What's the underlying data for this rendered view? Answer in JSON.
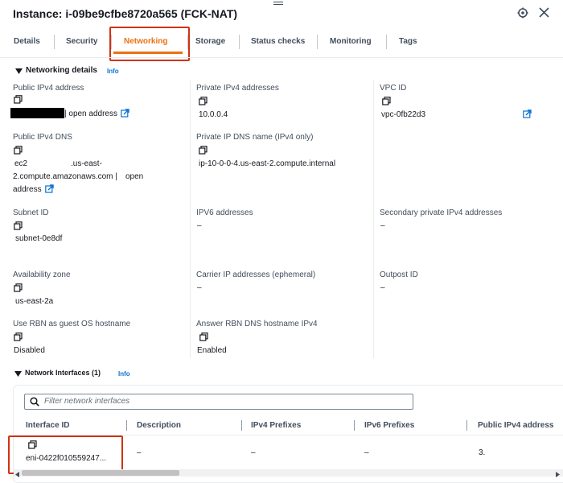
{
  "header": {
    "title": "Instance: i-09be9cfbe8720a565 (FCK-NAT)"
  },
  "tabs": [
    {
      "label": "Details"
    },
    {
      "label": "Security"
    },
    {
      "label": "Networking"
    },
    {
      "label": "Storage"
    },
    {
      "label": "Status checks"
    },
    {
      "label": "Monitoring"
    },
    {
      "label": "Tags"
    }
  ],
  "networking_details": {
    "heading": "Networking details",
    "info": "Info",
    "public_ipv4_address": {
      "label": "Public IPv4 address",
      "link": "| open address"
    },
    "private_ipv4_addresses": {
      "label": "Private IPv4 addresses",
      "value": "10.0.0.4"
    },
    "vpc_id": {
      "label": "VPC ID",
      "value": "vpc-0fb22d3"
    },
    "public_ipv4_dns": {
      "label": "Public IPv4 DNS",
      "line1_a": "ec2",
      "line1_b": ".us-east-",
      "line2": "2.compute.amazonaws.com |",
      "link_a": "open",
      "link_b": "address"
    },
    "private_ip_dns_name": {
      "label": "Private IP DNS name (IPv4 only)",
      "value": "ip-10-0-0-4.us-east-2.compute.internal"
    },
    "subnet_id": {
      "label": "Subnet ID",
      "value": "subnet-0e8df"
    },
    "ipv6_addresses": {
      "label": "IPV6 addresses",
      "value": "–"
    },
    "secondary_private_ipv4": {
      "label": "Secondary private IPv4 addresses",
      "value": "–"
    },
    "availability_zone": {
      "label": "Availability zone",
      "value": "us-east-2a"
    },
    "carrier_ip": {
      "label": "Carrier IP addresses (ephemeral)",
      "value": "–"
    },
    "outpost_id": {
      "label": "Outpost ID",
      "value": "–"
    },
    "rbn_hostname": {
      "label": "Use RBN as guest OS hostname",
      "value": "Disabled"
    },
    "answer_rbn": {
      "label": "Answer RBN DNS hostname IPv4",
      "value": "Enabled"
    }
  },
  "network_interfaces": {
    "heading": "Network Interfaces (1)",
    "info": "Info",
    "search_placeholder": "Filter network interfaces",
    "columns": [
      "Interface ID",
      "Description",
      "IPv4 Prefixes",
      "IPv6 Prefixes",
      "Public IPv4 address"
    ],
    "rows": [
      {
        "interface_id": "eni-0422f010559247...",
        "description": "–",
        "ipv4_prefixes": "–",
        "ipv6_prefixes": "–",
        "public_ipv4": "3."
      }
    ]
  }
}
